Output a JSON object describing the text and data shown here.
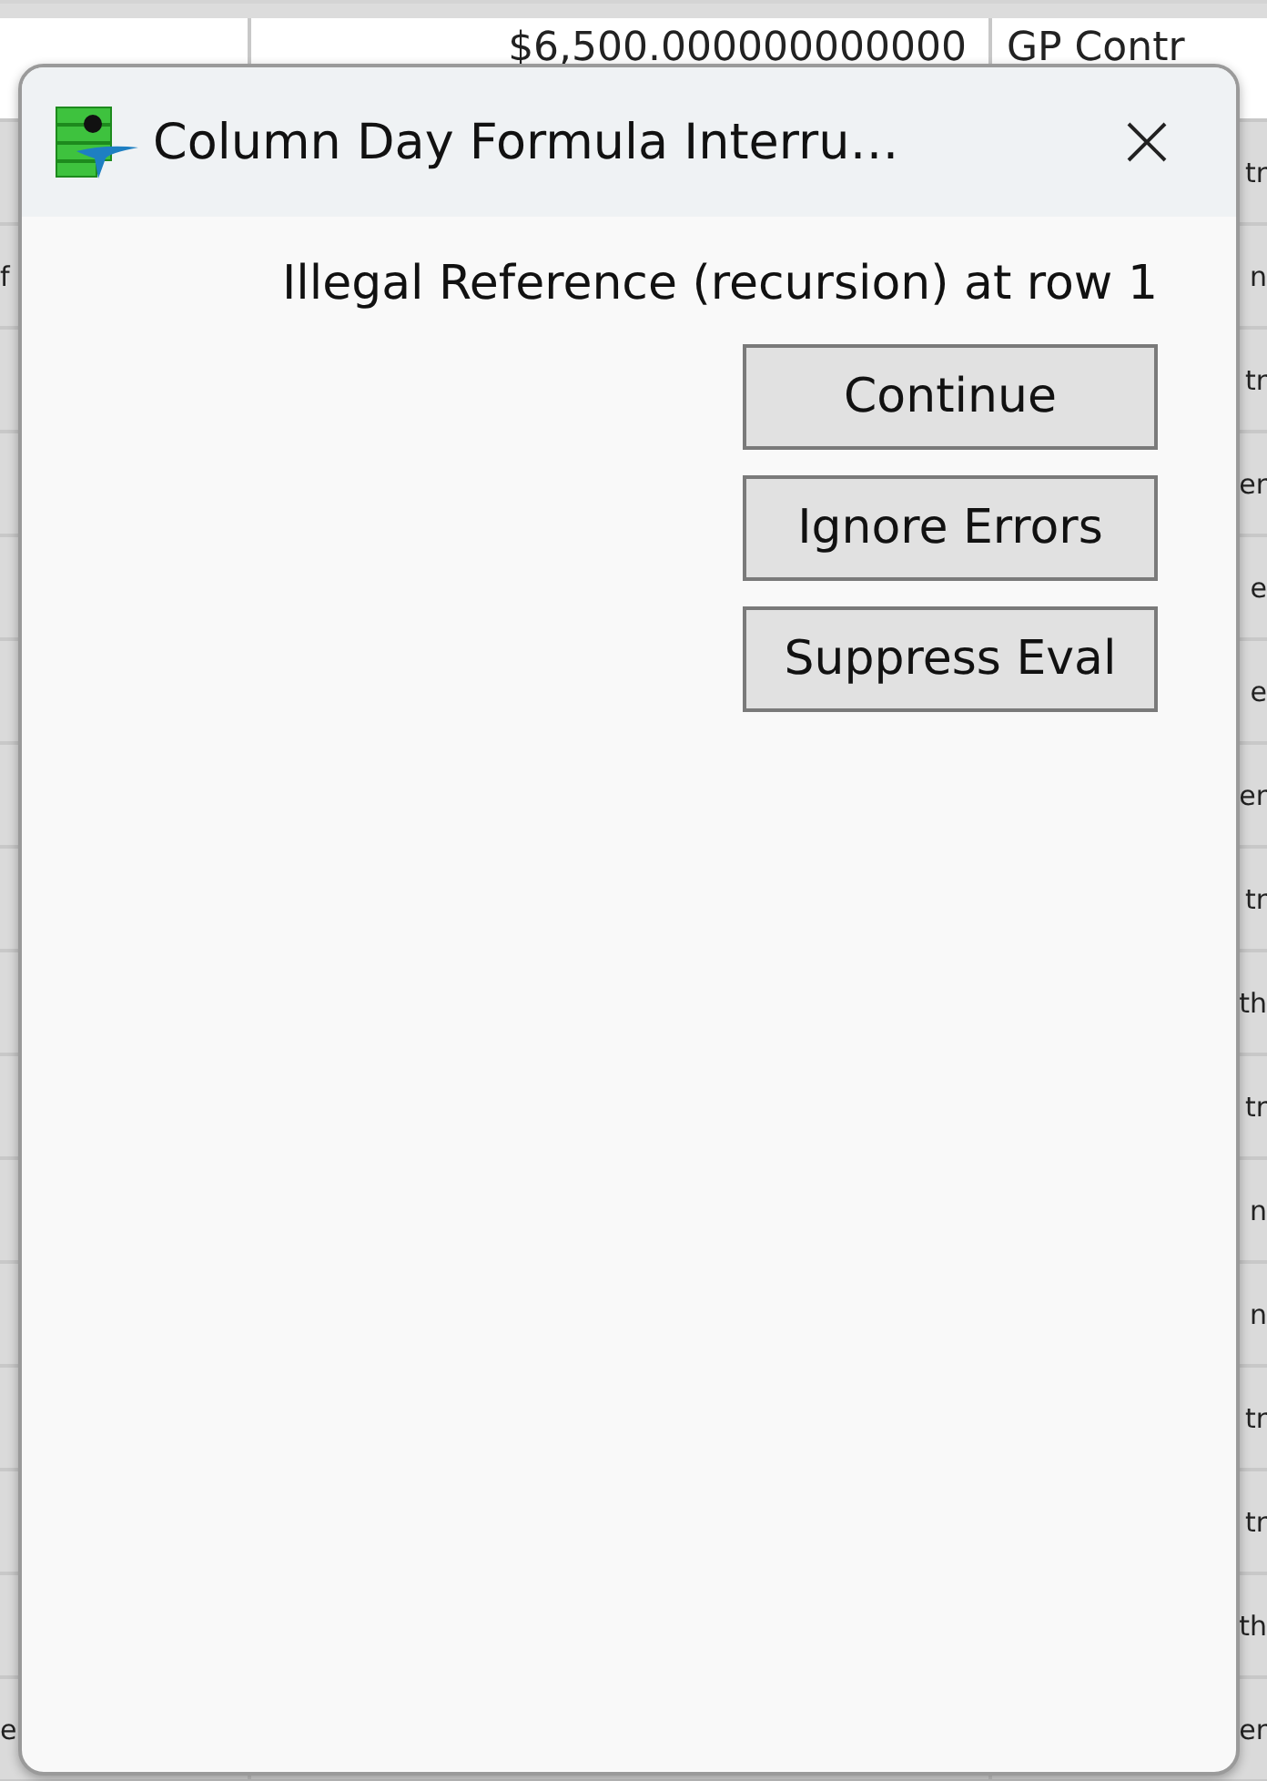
{
  "background_sheet": {
    "rows": [
      {
        "column_2": "$6,500.000000000000",
        "column_3": "GP Contr"
      },
      {
        "column_3": "tr"
      },
      {
        "column_1": "f",
        "column_3": "n"
      },
      {
        "column_3": "tr"
      },
      {
        "column_3": "er"
      },
      {
        "column_3": "e"
      },
      {
        "column_3": "e"
      },
      {
        "column_3": "er"
      },
      {
        "column_3": "tr"
      },
      {
        "column_3": "th"
      },
      {
        "column_3": "tr"
      },
      {
        "column_3": "n"
      },
      {
        "column_3": "n"
      },
      {
        "column_3": "tr"
      },
      {
        "column_3": "tr"
      },
      {
        "column_3": "th"
      },
      {
        "column_1": "e",
        "column_3": "er"
      }
    ]
  },
  "dialog": {
    "title": "Column Day Formula Interru…",
    "message": "Illegal Reference (recursion) at row 1",
    "buttons": [
      "Continue",
      "Ignore Errors",
      "Suppress Eval"
    ]
  }
}
